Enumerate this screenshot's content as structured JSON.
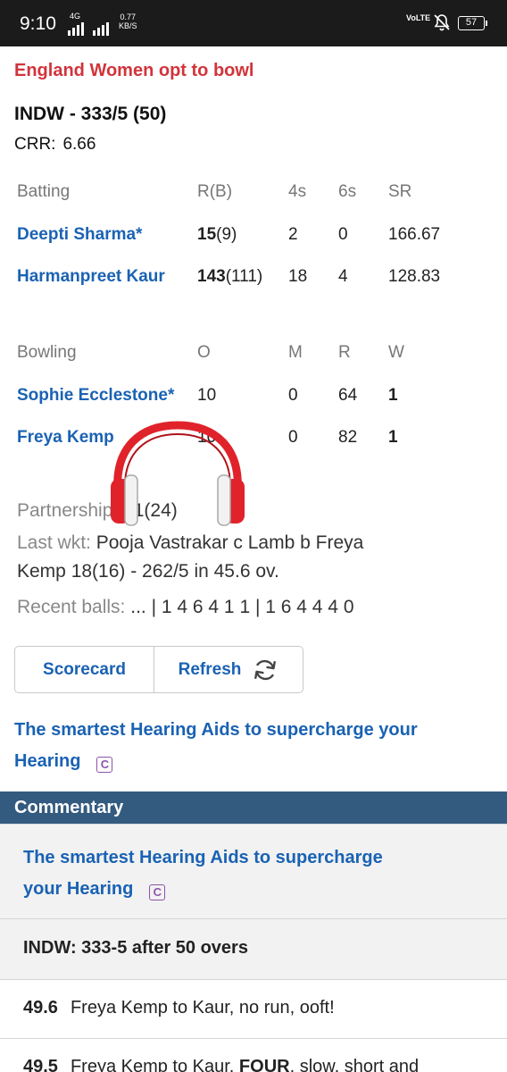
{
  "status_bar": {
    "time": "9:10",
    "network_label": "4G",
    "speed_value": "0.77",
    "speed_unit": "KB/S",
    "volte": "VoLTE",
    "battery": "57"
  },
  "match": {
    "toss": "England Women opt to bowl",
    "score": "INDW - 333/5 (50)",
    "crr_label": "CRR:",
    "crr_value": "6.66"
  },
  "batting": {
    "headers": [
      "Batting",
      "R(B)",
      "4s",
      "6s",
      "SR"
    ],
    "rows": [
      {
        "name": "Deepti Sharma*",
        "runs": "15",
        "balls": "(9)",
        "fours": "2",
        "sixes": "0",
        "sr": "166.67"
      },
      {
        "name": "Harmanpreet Kaur",
        "runs": "143",
        "balls": "(111)",
        "fours": "18",
        "sixes": "4",
        "sr": "128.83"
      }
    ]
  },
  "bowling": {
    "headers": [
      "Bowling",
      "O",
      "M",
      "R",
      "W"
    ],
    "rows": [
      {
        "name": "Sophie Ecclestone*",
        "overs": "10",
        "maidens": "0",
        "runs": "64",
        "wickets": "1"
      },
      {
        "name": "Freya Kemp",
        "overs": "10",
        "maidens": "0",
        "runs": "82",
        "wickets": "1"
      }
    ]
  },
  "info": {
    "partnership_label": "Partnership:",
    "partnership_value": "71(24)",
    "last_wkt_label": "Last wkt:",
    "last_wkt_line1": "Pooja Vastrakar c Lamb b Freya",
    "last_wkt_line2": "Kemp 18(16) - 262/5 in 45.6 ov.",
    "recent_label": "Recent balls:",
    "recent_value": "... | 1 4 6 4 1 1 | 1 6 4 4 4 0"
  },
  "buttons": {
    "scorecard": "Scorecard",
    "refresh": "Refresh"
  },
  "ad": {
    "line1": "The smartest Hearing Aids to supercharge your",
    "line2": "Hearing",
    "badge": "C"
  },
  "commentary": {
    "header": "Commentary",
    "ad_line1": "The smartest Hearing Aids to supercharge",
    "ad_line2": "your Hearing",
    "summary": "INDW: 333-5 after 50 overs",
    "balls": [
      {
        "over": "49.6",
        "text_before": "Freya Kemp to Kaur, no run, ooft!",
        "bold": "",
        "text_after": ""
      },
      {
        "over": "49.5",
        "text_before": "Freya Kemp to Kaur, ",
        "bold": "FOUR",
        "text_after": ", slow, short and"
      }
    ]
  },
  "colors": {
    "accent_blue": "#1a62b3",
    "header_bar": "#335b7f",
    "toss_red": "#d1343b",
    "headphone_red": "#e0232b"
  }
}
